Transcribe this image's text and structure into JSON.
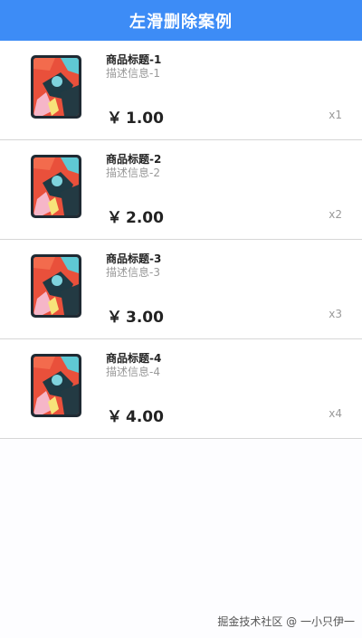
{
  "header": {
    "title": "左滑删除案例"
  },
  "currency_symbol": "￥",
  "items": [
    {
      "title": "商品标题-1",
      "desc": "描述信息-1",
      "price": "1.00",
      "qty": "x1"
    },
    {
      "title": "商品标题-2",
      "desc": "描述信息-2",
      "price": "2.00",
      "qty": "x2"
    },
    {
      "title": "商品标题-3",
      "desc": "描述信息-3",
      "price": "3.00",
      "qty": "x3"
    },
    {
      "title": "商品标题-4",
      "desc": "描述信息-4",
      "price": "4.00",
      "qty": "x4"
    }
  ],
  "footer": {
    "watermark": "掘金技术社区 @ 一小只伊一"
  },
  "colors": {
    "header_bg": "#3d8cf6",
    "divider": "#d6d6d6"
  }
}
